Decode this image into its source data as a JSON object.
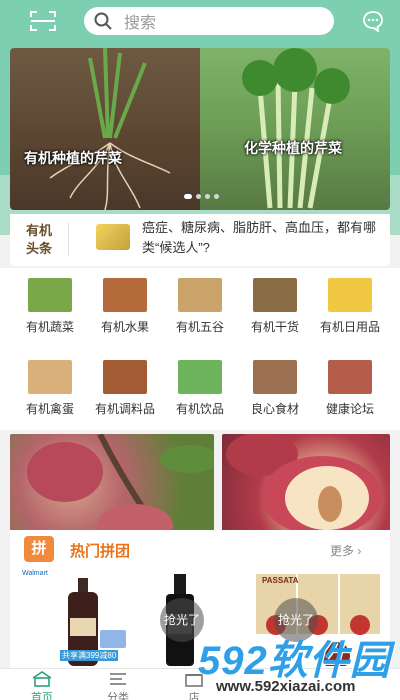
{
  "header": {
    "search_placeholder": "搜索",
    "scan_icon": "scan-icon",
    "message_icon": "message-icon"
  },
  "banner": {
    "left_caption": "有机种植的芹菜",
    "right_caption": "化学种植的芹菜",
    "indicator": {
      "count": 4,
      "active": 1
    }
  },
  "news": {
    "label_line1": "有机",
    "label_line2": "头条",
    "text": "癌症、糖尿病、脂肪肝、高血压，都有哪类“候选人”?"
  },
  "categories": [
    {
      "label": "有机蔬菜",
      "color": "#7aa848"
    },
    {
      "label": "有机水果",
      "color": "#b56a3b"
    },
    {
      "label": "有机五谷",
      "color": "#c9a36a"
    },
    {
      "label": "有机干货",
      "color": "#8b6d45"
    },
    {
      "label": "有机日用品",
      "color": "#f0c842"
    },
    {
      "label": "有机禽蛋",
      "color": "#d9b07a"
    },
    {
      "label": "有机调料品",
      "color": "#a25b32"
    },
    {
      "label": "有机饮品",
      "color": "#6db35c"
    },
    {
      "label": "良心食材",
      "color": "#9a7050"
    },
    {
      "label": "健康论坛",
      "color": "#b65c4a"
    }
  ],
  "group_buy": {
    "badge": "拼",
    "title": "热门拼团",
    "more": "更多",
    "sold_out": "抢光了",
    "products": [
      {
        "brand_small": "Walmart",
        "tag": "共享满399减80"
      },
      {
        "brand_small": "",
        "tag": ""
      },
      {
        "brand_small": "PASSATA",
        "tag": ""
      }
    ]
  },
  "tabbar": {
    "tabs": [
      {
        "label": "首页",
        "icon": "home-icon",
        "active": true
      },
      {
        "label": "分类",
        "icon": "category-icon",
        "active": false
      },
      {
        "label": "店",
        "icon": "store-icon",
        "active": false
      }
    ]
  },
  "watermark": {
    "big": "592软件园",
    "url": "www.592xiazai.com"
  }
}
